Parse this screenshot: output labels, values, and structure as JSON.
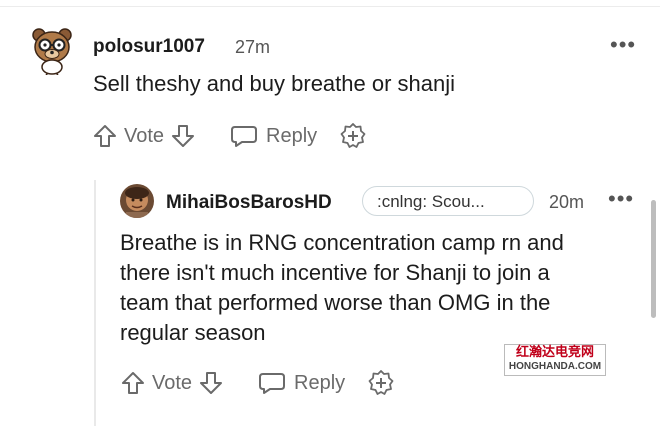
{
  "comment": {
    "username": "polosur1007",
    "time": "27m",
    "more": "•••",
    "text": "Sell theshy and buy breathe or shanji",
    "vote_label": "Vote",
    "reply_label": "Reply"
  },
  "reply": {
    "username": "MihaiBosBarosHD",
    "flair": ":cnlng: Scou...",
    "time": "20m",
    "more": "•••",
    "lines": [
      "Breathe is in RNG concentration camp rn and",
      "there isn't much incentive for Shanji to join a",
      "team that performed worse than OMG in the",
      "regular season"
    ],
    "vote_label": "Vote",
    "reply_label": "Reply"
  },
  "watermark": {
    "line1": "红瀚达电竞网",
    "line2": "HONGHANDA.COM"
  },
  "colors": {
    "text": "#1c1c1c",
    "meta": "#6a6a6a",
    "watermark_red": "#c0001a"
  }
}
